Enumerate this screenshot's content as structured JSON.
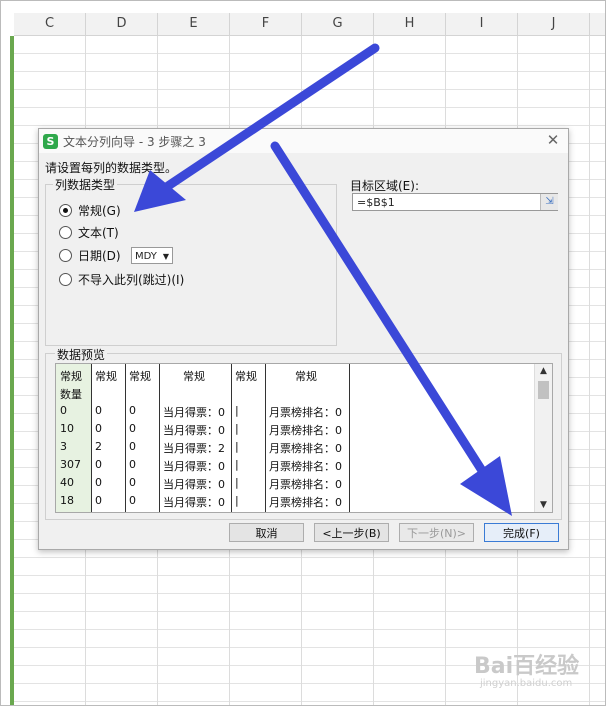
{
  "spreadsheet": {
    "columns": [
      "C",
      "D",
      "E",
      "F",
      "G",
      "H",
      "I",
      "J"
    ]
  },
  "dialog": {
    "title": "文本分列向导 - 3 步骤之 3",
    "app_icon": "S",
    "prompt": "请设置每列的数据类型。",
    "column_type_group": "列数据类型",
    "options": [
      {
        "label": "常规(G)",
        "selected": true
      },
      {
        "label": "文本(T)",
        "selected": false
      },
      {
        "label": "日期(D)",
        "selected": false
      },
      {
        "label": "不导入此列(跳过)(I)",
        "selected": false
      }
    ],
    "date_format": "MDY",
    "target_label": "目标区域(E):",
    "target_value": "=$B$1",
    "preview_label": "数据预览",
    "preview": {
      "headers": [
        "常规",
        "常规",
        "常规",
        "常规",
        "常规",
        "常规"
      ],
      "rows": [
        [
          "数量",
          "",
          "",
          "",
          "",
          ""
        ],
        [
          "0",
          "0",
          "0",
          "当月得票：0",
          "|",
          "月票榜排名：0"
        ],
        [
          "10",
          "0",
          "0",
          "当月得票：0",
          "|",
          "月票榜排名：0"
        ],
        [
          "3",
          "2",
          "0",
          "当月得票：2",
          "|",
          "月票榜排名：0"
        ],
        [
          "307",
          "0",
          "0",
          "当月得票：0",
          "|",
          "月票榜排名：0"
        ],
        [
          "40",
          "0",
          "0",
          "当月得票：0",
          "|",
          "月票榜排名：0"
        ],
        [
          "18",
          "0",
          "0",
          "当月得票：0",
          "|",
          "月票榜排名：0"
        ]
      ]
    },
    "buttons": {
      "cancel": "取消",
      "prev": "<上一步(B)",
      "next": "下一步(N)>",
      "finish": "完成(F)"
    }
  },
  "annotation_color": "#3b48d8",
  "watermark": {
    "brand": "Bai百经验",
    "url": "jingyan.baidu.com"
  }
}
